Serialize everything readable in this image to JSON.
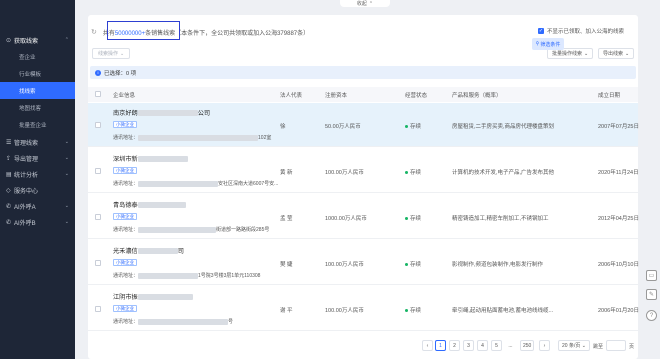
{
  "top": {
    "collapse_label": "收起",
    "collapse_icon": "chevron-up-icon"
  },
  "sidebar": {
    "groups": [
      {
        "label": "获取线索",
        "icon": "target-icon",
        "open": true,
        "items": [
          "查企业",
          "行业模板",
          "找线索",
          "地图找客",
          "批量查企业"
        ],
        "active": 2
      },
      {
        "label": "管理线索",
        "icon": "list-icon"
      },
      {
        "label": "导出管理",
        "icon": "export-icon"
      },
      {
        "label": "统计分析",
        "icon": "chart-icon"
      },
      {
        "label": "服务中心",
        "icon": "service-icon"
      },
      {
        "label": "AI外呼A",
        "icon": "phone-icon"
      },
      {
        "label": "AI外呼B",
        "icon": "phone-icon"
      }
    ]
  },
  "summary": {
    "prefix": "共有",
    "count": "50000000+",
    "suffix": "条销售线索（本条件下，全公司共领取或加入公海379887条）"
  },
  "options": {
    "hide_taken": "不显示已领取、加入公海的线索",
    "filter_button": "筛选条件"
  },
  "toolbar": {
    "leads_ops": "线索操作",
    "batch_ops": "批量操作线索",
    "export": "导出线索"
  },
  "selection": {
    "text": "已选择：0 项"
  },
  "table": {
    "headers": [
      "企业信息",
      "法人代表",
      "注册资本",
      "经营状态",
      "产品和服务（概率）",
      "成立日期"
    ],
    "rows": [
      {
        "name_start": "南京好朗",
        "name_end": "公司",
        "tag": "小微企业",
        "addr_label": "通讯地址：",
        "addr_end": "102室",
        "rep": "徐",
        "capital": "50.00万人民币",
        "status": "存续",
        "products": "房屋租赁,二手房买卖,商品房代理楼盘策划",
        "date": "2007年07月25日"
      },
      {
        "name_start": "深圳市新",
        "name_end": "",
        "tag": "小微企业",
        "addr_label": "通讯地址：",
        "addr_end": "安社区深南大道6007号安...",
        "rep": "黄 新",
        "capital": "100.00万人民币",
        "status": "存续",
        "products": "计算机的技术开发,电子产品,广告发布其他",
        "date": "2020年11月24日"
      },
      {
        "name_start": "青岛德泰",
        "name_end": "",
        "tag": "小微企业",
        "addr_label": "通讯地址：",
        "addr_end": "街道部一路路街段285号",
        "rep": "孟 莹",
        "capital": "1000.00万人民币",
        "status": "存续",
        "products": "精密铸造加工,精密车削加工,不锈钢加工",
        "date": "2012年04月25日"
      },
      {
        "name_start": "光禾濃信",
        "name_end": "司",
        "tag": "小微企业",
        "addr_label": "通讯地址：",
        "addr_end": "1号院3号楼3层1单元110308",
        "rep": "樊 婕",
        "capital": "100.00万人民币",
        "status": "存续",
        "products": "影视制作,频道包装制作,电影发行制作",
        "date": "2006年10月10日"
      },
      {
        "name_start": "江阴市振",
        "name_end": "",
        "tag": "小微企业",
        "addr_label": "通讯地址：",
        "addr_end": "号",
        "rep": "谢 平",
        "capital": "100.00万人民币",
        "status": "存续",
        "products": "牵引绳,起动用贴面蓄电池,蓄电池线线缆...",
        "date": "2006年01月20日"
      }
    ]
  },
  "pagination": {
    "pages": [
      "1",
      "2",
      "3",
      "4",
      "5",
      "...",
      "250"
    ],
    "current": "1",
    "page_size": "20 条/页",
    "goto_label": "跳至",
    "page_unit": "页"
  },
  "colors": {
    "sidebar_bg": "#1e2637",
    "accent": "#2f6bff",
    "highlight_row": "#e6f2fb",
    "status_green": "#18b566"
  }
}
